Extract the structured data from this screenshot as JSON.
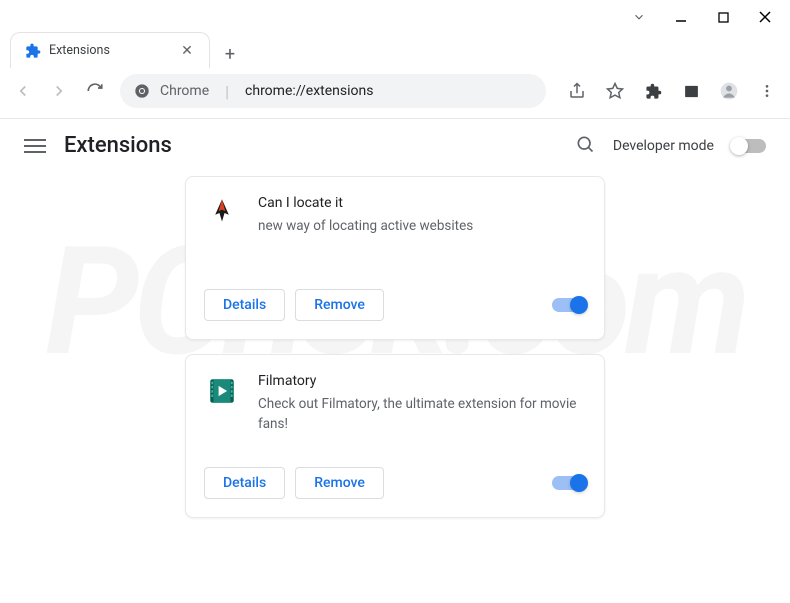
{
  "window": {
    "tab_title": "Extensions",
    "url_prefix": "Chrome",
    "url_path": "chrome://extensions"
  },
  "header": {
    "title": "Extensions",
    "developer_mode_label": "Developer mode",
    "developer_mode_on": false
  },
  "buttons": {
    "details": "Details",
    "remove": "Remove"
  },
  "extensions": [
    {
      "name": "Can I locate it",
      "description": "new way of locating active websites",
      "enabled": true,
      "icon": "bird"
    },
    {
      "name": "Filmatory",
      "description": "Check out Filmatory, the ultimate extension for movie fans!",
      "enabled": true,
      "icon": "film"
    }
  ]
}
